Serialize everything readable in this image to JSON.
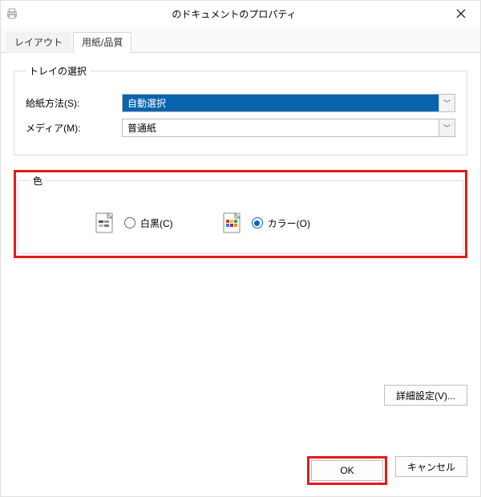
{
  "titlebar": {
    "title": "のドキュメントのプロパティ"
  },
  "tabs": {
    "layout": "レイアウト",
    "paper": "用紙/品質"
  },
  "tray_group": {
    "legend": "トレイの選択",
    "source_label": "給紙方法(S):",
    "source_value": "自動選択",
    "media_label": "メディア(M):",
    "media_value": "普通紙"
  },
  "color_group": {
    "legend": "色",
    "bw_label": "白黒(C)",
    "color_label": "カラー(O)"
  },
  "buttons": {
    "advanced": "詳細設定(V)...",
    "ok": "OK",
    "cancel": "キャンセル"
  }
}
